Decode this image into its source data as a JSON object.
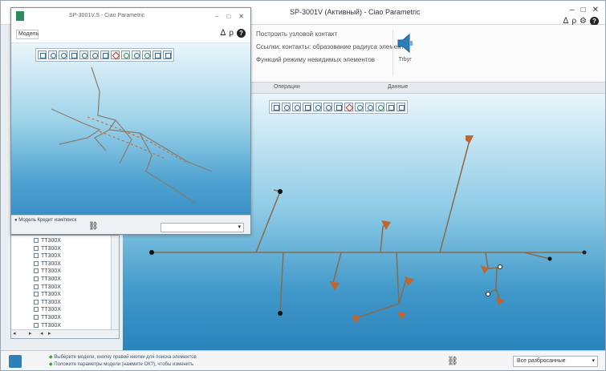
{
  "main_window": {
    "title": "SP-3001V (Активный) - Ciao Parametric",
    "controls": [
      "–",
      "□",
      "✕"
    ],
    "help": [
      "ᐃ",
      "ρ",
      "⚙",
      "?"
    ]
  },
  "ribbon": {
    "commands": [
      "Построить узловой контакт",
      "Ссылки: контакты: образование радиуса элемента",
      "Функций режиму невидимых элементов"
    ],
    "big_button_label": "Trbyr",
    "groups": [
      "Операции",
      "Данные"
    ]
  },
  "float_window": {
    "title": "SP-3001V.S - Ciao Parametric",
    "controls": [
      "–",
      "□",
      "✕"
    ],
    "mode_select": "Модель",
    "help": [
      "ᐃ",
      "ρ",
      "?"
    ],
    "status_label": "● Модель Кредит изм/поиск"
  },
  "tree": {
    "items": [
      "TT300X",
      "TT300X",
      "TT300X",
      "TT300X",
      "TT300X",
      "TT300X",
      "TT300X",
      "TT300X",
      "TT300X",
      "TT300X",
      "TT300X",
      "TT300X",
      "TT300X"
    ],
    "scroll_labels": [
      "◂",
      "▸",
      "◂",
      "▸"
    ]
  },
  "status_bar": {
    "messages": [
      "Выберите модели, кнопку правой кнопки для поиска элементов",
      "Положите параметры модели (нажмите ОК?), чтобы изменить"
    ],
    "filter_value": "Все разбросанные"
  },
  "colors": {
    "pipe": "#8a6a4c",
    "valve": "#c0652f",
    "viewport_top": "#e9f5fb",
    "viewport_bottom": "#2a83bb"
  }
}
